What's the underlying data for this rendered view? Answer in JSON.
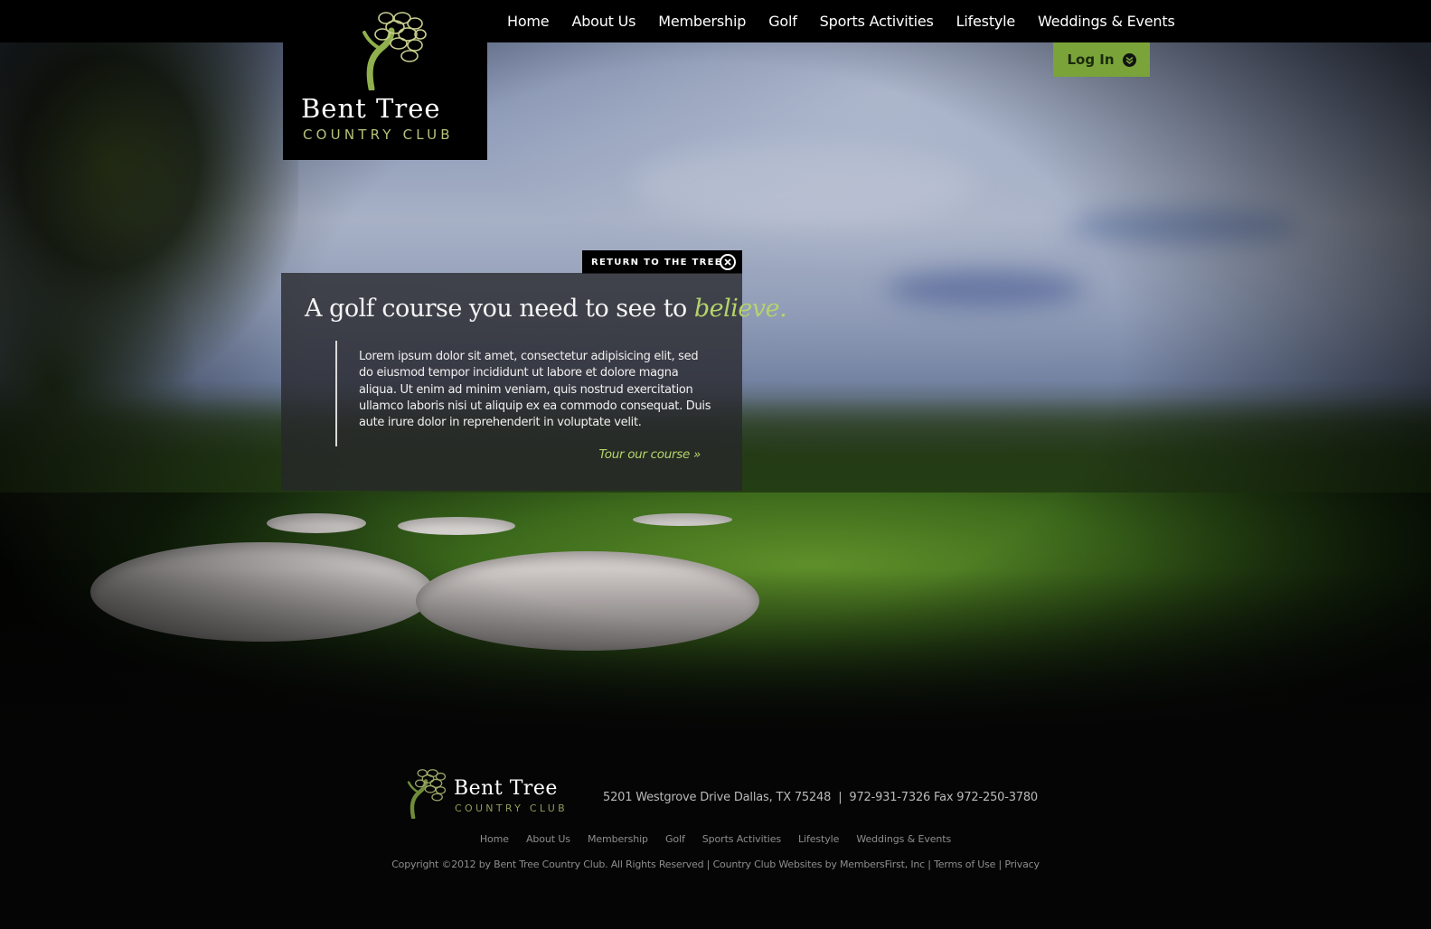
{
  "nav": {
    "items": [
      "Home",
      "About Us",
      "Membership",
      "Golf",
      "Sports Activities",
      "Lifestyle",
      "Weddings & Events"
    ]
  },
  "logo": {
    "name": "Bent Tree",
    "tagline": "COUNTRY CLUB"
  },
  "login": {
    "label": "Log In",
    "icon": "chevron-down-icon"
  },
  "return_tab": {
    "label": "RETURN TO THE TREE",
    "icon": "close-icon"
  },
  "panel": {
    "headline_main": "A golf course you need to see to ",
    "headline_accent": "believe.",
    "body": "Lorem ipsum dolor sit amet, consectetur adipisicing elit, sed do eiusmod tempor incididunt ut labore et dolore magna aliqua. Ut enim ad minim veniam, quis nostrud exercitation ullamco laboris nisi ut aliquip ex ea commodo consequat. Duis aute irure dolor in reprehenderit in voluptate velit.",
    "cta": "Tour our course »"
  },
  "footer": {
    "logo_name": "Bent Tree",
    "logo_tagline": "COUNTRY CLUB",
    "address": "5201 Westgrove Drive Dallas, TX 75248",
    "address_sep": "|",
    "phone": "972-931-7326 Fax 972-250-3780",
    "nav": [
      "Home",
      "About Us",
      "Membership",
      "Golf",
      "Sports Activities",
      "Lifestyle",
      "Weddings & Events"
    ],
    "copyright_text": "Copyright ©2012 by Bent Tree Country Club. All Rights Reserved",
    "sep": "|",
    "credit_link": "Country Club Websites by MembersFirst, Inc",
    "terms_link": "Terms of Use",
    "privacy_link": "Privacy"
  },
  "colors": {
    "accent_green": "#b6d36a",
    "login_green": "#7aa33a",
    "logo_tagline": "#b7c27a",
    "background": "#050505"
  }
}
